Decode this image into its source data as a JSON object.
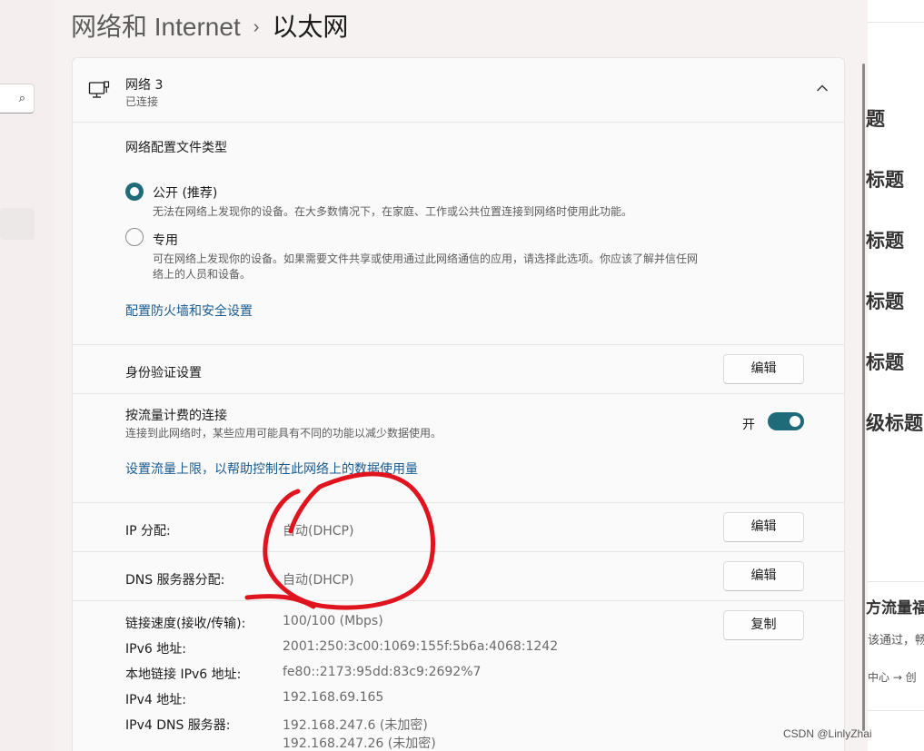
{
  "breadcrumb": {
    "parent": "网络和 Internet",
    "separator": "›",
    "current": "以太网"
  },
  "search": {
    "icon": "search-icon"
  },
  "network": {
    "name": "网络 3",
    "status": "已连接",
    "icon": "ethernet-icon"
  },
  "profile": {
    "heading": "网络配置文件类型",
    "options": [
      {
        "label": "公开 (推荐)",
        "description": "无法在网络上发现你的设备。在大多数情况下，在家庭、工作或公共位置连接到网络时使用此功能。",
        "selected": true
      },
      {
        "label": "专用",
        "description_line1": "可在网络上发现你的设备。如果需要文件共享或使用通过此网络通信的应用，请选择此选项。你应该了解并信任网",
        "description_line2": "络上的人员和设备。",
        "selected": false
      }
    ],
    "firewall_link": "配置防火墙和安全设置"
  },
  "auth": {
    "label": "身份验证设置",
    "button": "编辑"
  },
  "metered": {
    "label": "按流量计费的连接",
    "description": "连接到此网络时，某些应用可能具有不同的功能以减少数据使用。",
    "toggle_text": "开",
    "toggle_on": true,
    "data_limit_link": "设置流量上限，以帮助控制在此网络上的数据使用量"
  },
  "ip_assignment": {
    "label": "IP 分配:",
    "value": "自动(DHCP)",
    "button": "编辑"
  },
  "dns_assignment": {
    "label": "DNS 服务器分配:",
    "value": "自动(DHCP)",
    "button": "编辑"
  },
  "properties": {
    "copy_button": "复制",
    "rows": [
      {
        "label": "链接速度(接收/传输):",
        "value": "100/100 (Mbps)"
      },
      {
        "label": "IPv6 地址:",
        "value": "2001:250:3c00:1069:155f:5b6a:4068:1242"
      },
      {
        "label": "本地链接 IPv6 地址:",
        "value": "fe80::2173:95dd:83c9:2692%7"
      },
      {
        "label": "IPv4 地址:",
        "value": "192.168.69.165"
      },
      {
        "label": "IPv4 DNS 服务器:",
        "value": "192.168.247.6 (未加密)",
        "value2": "192.168.247.26 (未加密)"
      }
    ]
  },
  "background_page": {
    "headings": [
      "题",
      "标题",
      "标题",
      "标题",
      "标题",
      "级标题"
    ],
    "snippet_title": "方流量福",
    "snippet_line1": "该通过，畅",
    "snippet_line2": "中心 → 创"
  },
  "watermark": "CSDN @LinlyZhai",
  "colors": {
    "accent": "#1f6b79",
    "link": "#1a5b8f",
    "annotation": "#e0141e"
  }
}
